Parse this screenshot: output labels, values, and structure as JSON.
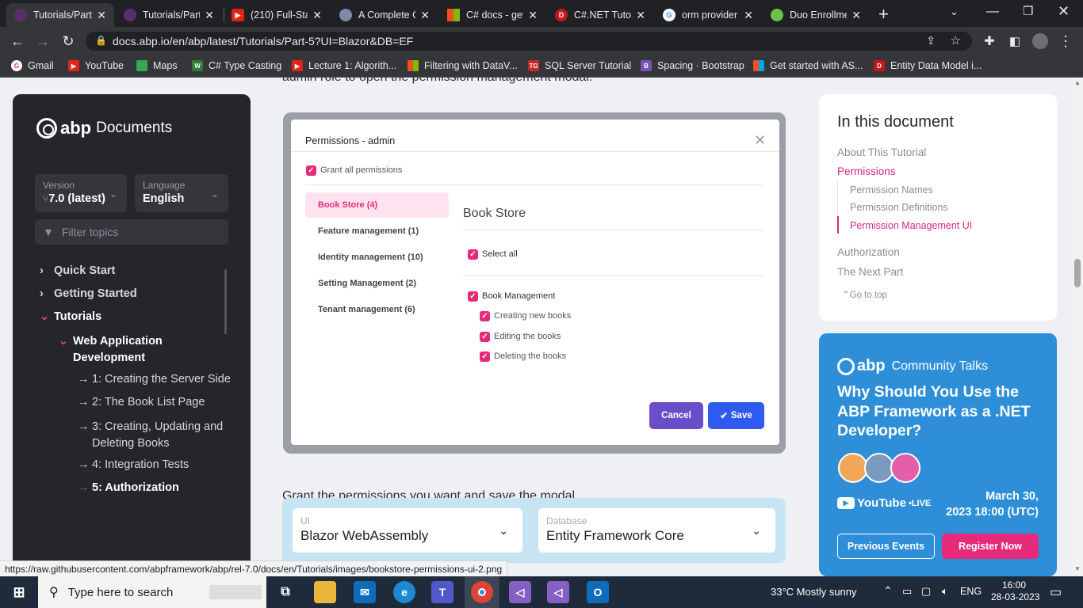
{
  "browser": {
    "tabs": [
      {
        "title": "Tutorials/Part",
        "active": true
      },
      {
        "title": "Tutorials/Part",
        "active": false
      },
      {
        "title": "(210) Full-Sta",
        "active": false
      },
      {
        "title": "A Complete G",
        "active": false
      },
      {
        "title": "C# docs - get",
        "active": false
      },
      {
        "title": "C#.NET Tutor",
        "active": false
      },
      {
        "title": "orm provider",
        "active": false
      },
      {
        "title": "Duo Enrollme",
        "active": false
      }
    ],
    "new_tab_label": "+",
    "url": "docs.abp.io/en/abp/latest/Tutorials/Part-5?UI=Blazor&DB=EF",
    "bookmarks": [
      "Gmail",
      "YouTube",
      "Maps",
      "C# Type Casting",
      "Lecture 1: Algorith...",
      "Filtering with DataV...",
      "SQL Server Tutorial",
      "Spacing · Bootstrap",
      "Get started with AS...",
      "Entity Data Model i..."
    ],
    "status_url": "https://raw.githubusercontent.com/abpframework/abp/rel-7.0/docs/en/Tutorials/images/bookstore-permissions-ui-2.png"
  },
  "sidebar": {
    "brand": "abp",
    "title": "Documents",
    "version": {
      "label": "Version",
      "value": "7.0 (latest)"
    },
    "language": {
      "label": "Language",
      "value": "English"
    },
    "filter_placeholder": "Filter topics",
    "nav": [
      {
        "label": "Quick Start"
      },
      {
        "label": "Getting Started"
      },
      {
        "label": "Tutorials"
      },
      {
        "label": "Web Application Development"
      },
      {
        "label": "1: Creating the Server Side"
      },
      {
        "label": "2: The Book List Page"
      },
      {
        "label": "3: Creating, Updating and Deleting Books"
      },
      {
        "label": "4: Integration Tests"
      },
      {
        "label": "5: Authorization"
      }
    ]
  },
  "content": {
    "top_partial": "admin role to open the permission management modal:",
    "bottom_partial": "Grant the permissions you want and save the modal.",
    "modal": {
      "title": "Permissions - admin",
      "grant_all": "Grant all permissions",
      "tabs": [
        "Book Store (4)",
        "Feature management (1)",
        "Identity management (10)",
        "Setting Management (2)",
        "Tenant management (6)"
      ],
      "section_title": "Book Store",
      "select_all": "Select all",
      "group": "Book Management",
      "items": [
        "Creating new books",
        "Editing the books",
        "Deleting the books"
      ],
      "cancel": "Cancel",
      "save": "Save"
    },
    "ui_selector": {
      "label": "UI",
      "value": "Blazor WebAssembly"
    },
    "db_selector": {
      "label": "Database",
      "value": "Entity Framework Core"
    }
  },
  "toc": {
    "title": "In this document",
    "items": [
      "About This Tutorial",
      "Permissions",
      "Permission Names",
      "Permission Definitions",
      "Permission Management UI",
      "Authorization",
      "The Next Part"
    ],
    "go_top": "Go to top"
  },
  "promo": {
    "brand": "abp",
    "title": "Community Talks",
    "headline": "Why Should You Use the ABP Framework as a .NET Developer?",
    "youtube": "YouTube",
    "live": "•LIVE",
    "date": "March 30,",
    "time": "2023 18:00 (UTC)",
    "prev_btn": "Previous Events",
    "register_btn": "Register Now"
  },
  "taskbar": {
    "search_placeholder": "Type here to search",
    "weather": "33°C  Mostly sunny",
    "lang": "ENG",
    "time": "16:00",
    "date": "28-03-2023"
  },
  "colors": {
    "accent": "#e62a7a",
    "brand_pink": "#d4287f",
    "save_blue": "#2f5bf0",
    "cancel_purple": "#6a4ec9",
    "promo_blue": "#2e8fd8"
  }
}
